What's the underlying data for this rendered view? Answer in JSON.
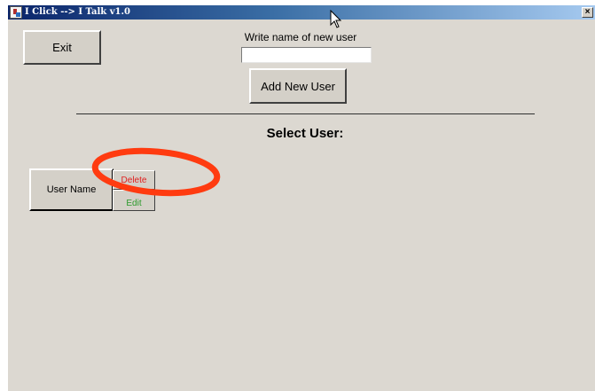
{
  "window": {
    "title": "I Click --> I Talk v1.0",
    "close_label": "×"
  },
  "toolbar": {
    "exit_label": "Exit"
  },
  "new_user": {
    "prompt_label": "Write name of new user",
    "input_value": "",
    "add_button_label": "Add New User"
  },
  "select_user": {
    "heading": "Select User:",
    "users": [
      {
        "name": "User Name",
        "delete_label": "Delete",
        "edit_label": "Edit"
      }
    ]
  },
  "colors": {
    "window_bg": "#dcd8d1",
    "titlebar_start": "#0a246a",
    "titlebar_end": "#a6caf0",
    "delete_text": "#e02020",
    "edit_text": "#2a9a2a",
    "annotation_ellipse": "#ff3b10"
  },
  "icons": {
    "app": "app-icon",
    "close": "close-icon",
    "cursor": "mouse-pointer-icon"
  }
}
